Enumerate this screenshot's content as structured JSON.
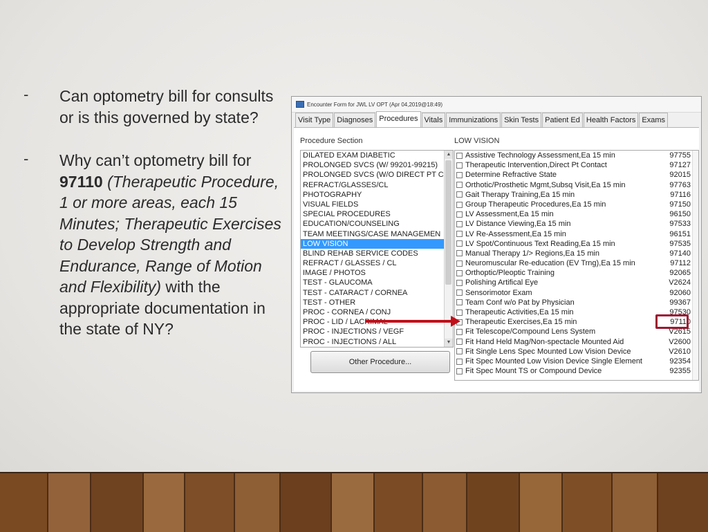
{
  "bullets": [
    {
      "dash": "-",
      "text": "Can optometry bill for consults or is this governed by state?"
    },
    {
      "dash": "-",
      "prefix": "Why can’t optometry bill for",
      "code": "97110",
      "italic": "(Therapeutic Procedure, 1 or more areas, each 15 Minutes; Therapeutic Exercises to Develop Strength and Endurance, Range of Motion and Flexibility)",
      "suffix": "with the appropriate documentation in the state of NY?"
    }
  ],
  "window": {
    "title": "Encounter Form for JWL LV OPT   (Apr 04,2019@18:49)",
    "tabs": [
      "Visit Type",
      "Diagnoses",
      "Procedures",
      "Vitals",
      "Immunizations",
      "Skin Tests",
      "Patient Ed",
      "Health Factors",
      "Exams"
    ],
    "active_tab": "Procedures",
    "procedure_section_label": "Procedure Section",
    "lv_section_label": "LOW VISION",
    "sections": [
      "DILATED EXAM DIABETIC",
      "PROLONGED SVCS (W/ 99201-99215)",
      "PROLONGED SVCS (W/O DIRECT PT C",
      "REFRACT/GLASSES/CL",
      "PHOTOGRAPHY",
      "VISUAL FIELDS",
      "SPECIAL PROCEDURES",
      "EDUCATION/COUNSELING",
      "TEAM MEETINGS/CASE MANAGEMEN",
      "LOW VISION",
      "BLIND REHAB SERVICE CODES",
      "REFRACT / GLASSES / CL",
      "IMAGE / PHOTOS",
      "TEST - GLAUCOMA",
      "TEST - CATARACT / CORNEA",
      "TEST - OTHER",
      "PROC - CORNEA / CONJ",
      "PROC - LID / LACRIMAL",
      "PROC - INJECTIONS / VEGF",
      "PROC - INJECTIONS / ALL"
    ],
    "selected_section": "LOW VISION",
    "other_button": "Other Procedure...",
    "procedures": [
      {
        "name": "Assistive Technology Assessment,Ea 15 min",
        "code": "97755"
      },
      {
        "name": "Therapeutic Intervention,Direct Pt Contact",
        "code": "97127"
      },
      {
        "name": "Determine Refractive State",
        "code": "92015"
      },
      {
        "name": "Orthotic/Prosthetic Mgmt,Subsq Visit,Ea 15 min",
        "code": "97763"
      },
      {
        "name": "Gait Therapy Training,Ea 15 min",
        "code": "97116"
      },
      {
        "name": "Group Therapeutic Procedures,Ea 15 min",
        "code": "97150"
      },
      {
        "name": "LV Assessment,Ea 15 min",
        "code": "96150"
      },
      {
        "name": "LV Distance Viewing,Ea 15 min",
        "code": "97533"
      },
      {
        "name": "LV Re-Assessment,Ea 15 min",
        "code": "96151"
      },
      {
        "name": "LV Spot/Continuous Text Reading,Ea 15 min",
        "code": "97535"
      },
      {
        "name": "Manual Therapy 1/> Regions,Ea 15 min",
        "code": "97140"
      },
      {
        "name": "Neuromuscular Re-education (EV Trng),Ea 15 min",
        "code": "97112"
      },
      {
        "name": "Orthoptic/Pleoptic Training",
        "code": "92065"
      },
      {
        "name": "Polishing Artifical Eye",
        "code": "V2624"
      },
      {
        "name": "Sensorimotor Exam",
        "code": "92060"
      },
      {
        "name": "Team Conf w/o Pat by Physician",
        "code": "99367"
      },
      {
        "name": "Therapeutic Activities,Ea 15 min",
        "code": "97530"
      },
      {
        "name": "Therapeutic Exercises,Ea 15 min",
        "code": "97110"
      },
      {
        "name": "Fit Telescope/Compound Lens System",
        "code": "V2615"
      },
      {
        "name": "Fit Hand Held Mag/Non-spectacle Mounted Aid",
        "code": "V2600"
      },
      {
        "name": "Fit Single Lens Spec Mounted Low Vision Device",
        "code": "V2610"
      },
      {
        "name": "Fit Spec Mounted Low Vision Device Single Element",
        "code": "92354"
      },
      {
        "name": "Fit Spec Mount TS or Compound Device",
        "code": "92355"
      }
    ],
    "highlighted_code": "97110"
  },
  "colors": {
    "annotation_arrow": "#c0101a",
    "annotation_box": "#9c1830",
    "selection": "#3399ff"
  }
}
